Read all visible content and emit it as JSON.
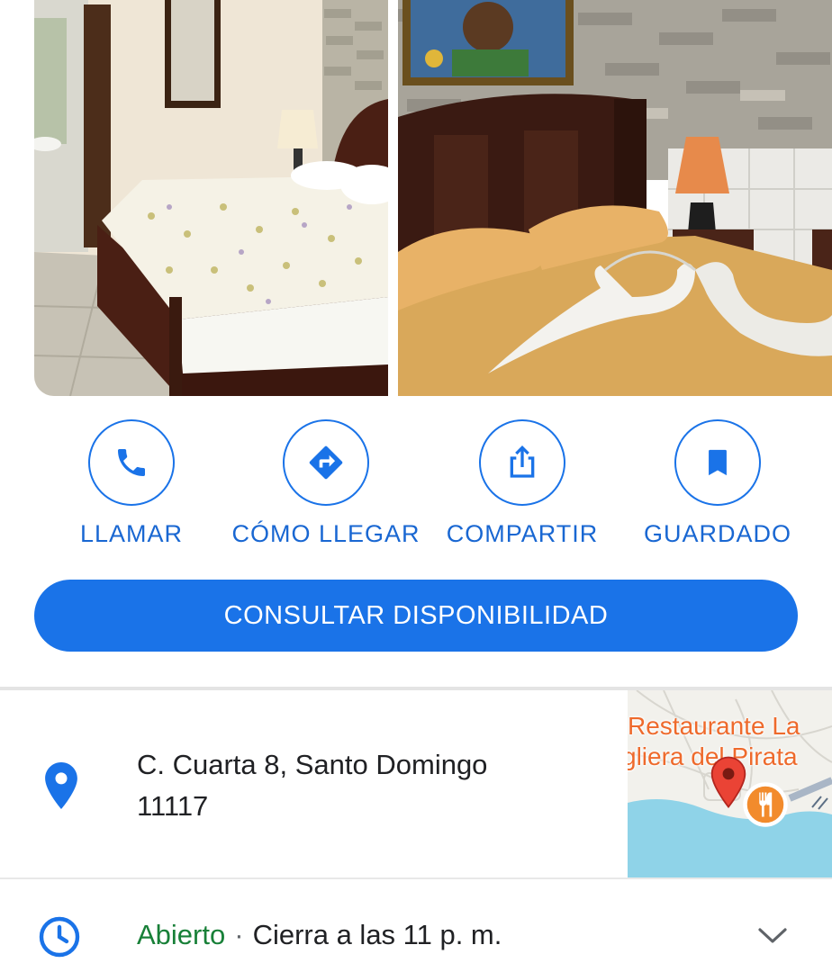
{
  "actions": {
    "call_label": "LLAMAR",
    "directions_label": "CÓMO LLEGAR",
    "share_label": "COMPARTIR",
    "saved_label": "GUARDADO"
  },
  "cta": {
    "label": "CONSULTAR DISPONIBILIDAD"
  },
  "address": {
    "line1": "C. Cuarta 8, Santo Domingo",
    "line2": "11117"
  },
  "map": {
    "label_line1": "Restaurante La",
    "label_line2": "gliera del Pirata"
  },
  "hours": {
    "status": "Abierto",
    "separator": "·",
    "closes": "Cierra a las 11 p. m."
  },
  "icons": {
    "call": "phone-icon",
    "directions": "directions-icon",
    "share": "share-icon",
    "saved": "bookmark-icon",
    "address": "location-pin-icon",
    "hours": "clock-icon",
    "expand": "chevron-down-icon",
    "map_pin": "map-pin-icon",
    "restaurant": "restaurant-icon"
  },
  "colors": {
    "accent": "#1a73e8",
    "open": "#188038",
    "map_label": "#ee6a2c",
    "map_pin": "#ea4335"
  }
}
